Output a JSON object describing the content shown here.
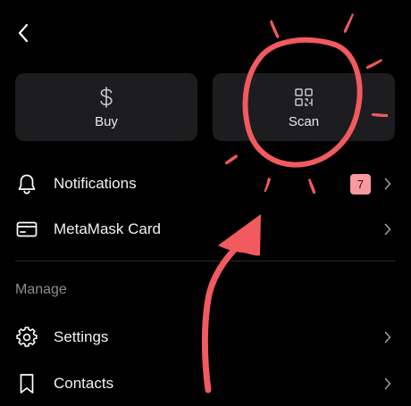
{
  "nav": {
    "back_icon": "chevron-left-icon"
  },
  "quick_actions": [
    {
      "label": "Buy",
      "icon": "dollar-icon"
    },
    {
      "label": "Scan",
      "icon": "qr-code-icon"
    }
  ],
  "menu": {
    "notifications": {
      "label": "Notifications",
      "icon": "bell-icon",
      "badge": "7"
    },
    "card": {
      "label": "MetaMask Card",
      "icon": "credit-card-icon"
    }
  },
  "manage": {
    "title": "Manage",
    "settings": {
      "label": "Settings",
      "icon": "gear-icon"
    },
    "contacts": {
      "label": "Contacts",
      "icon": "bookmark-icon"
    }
  },
  "colors": {
    "background": "#000000",
    "tile": "#1d1d1f",
    "badge": "#f8999f",
    "annotation": "#f15a5e"
  }
}
